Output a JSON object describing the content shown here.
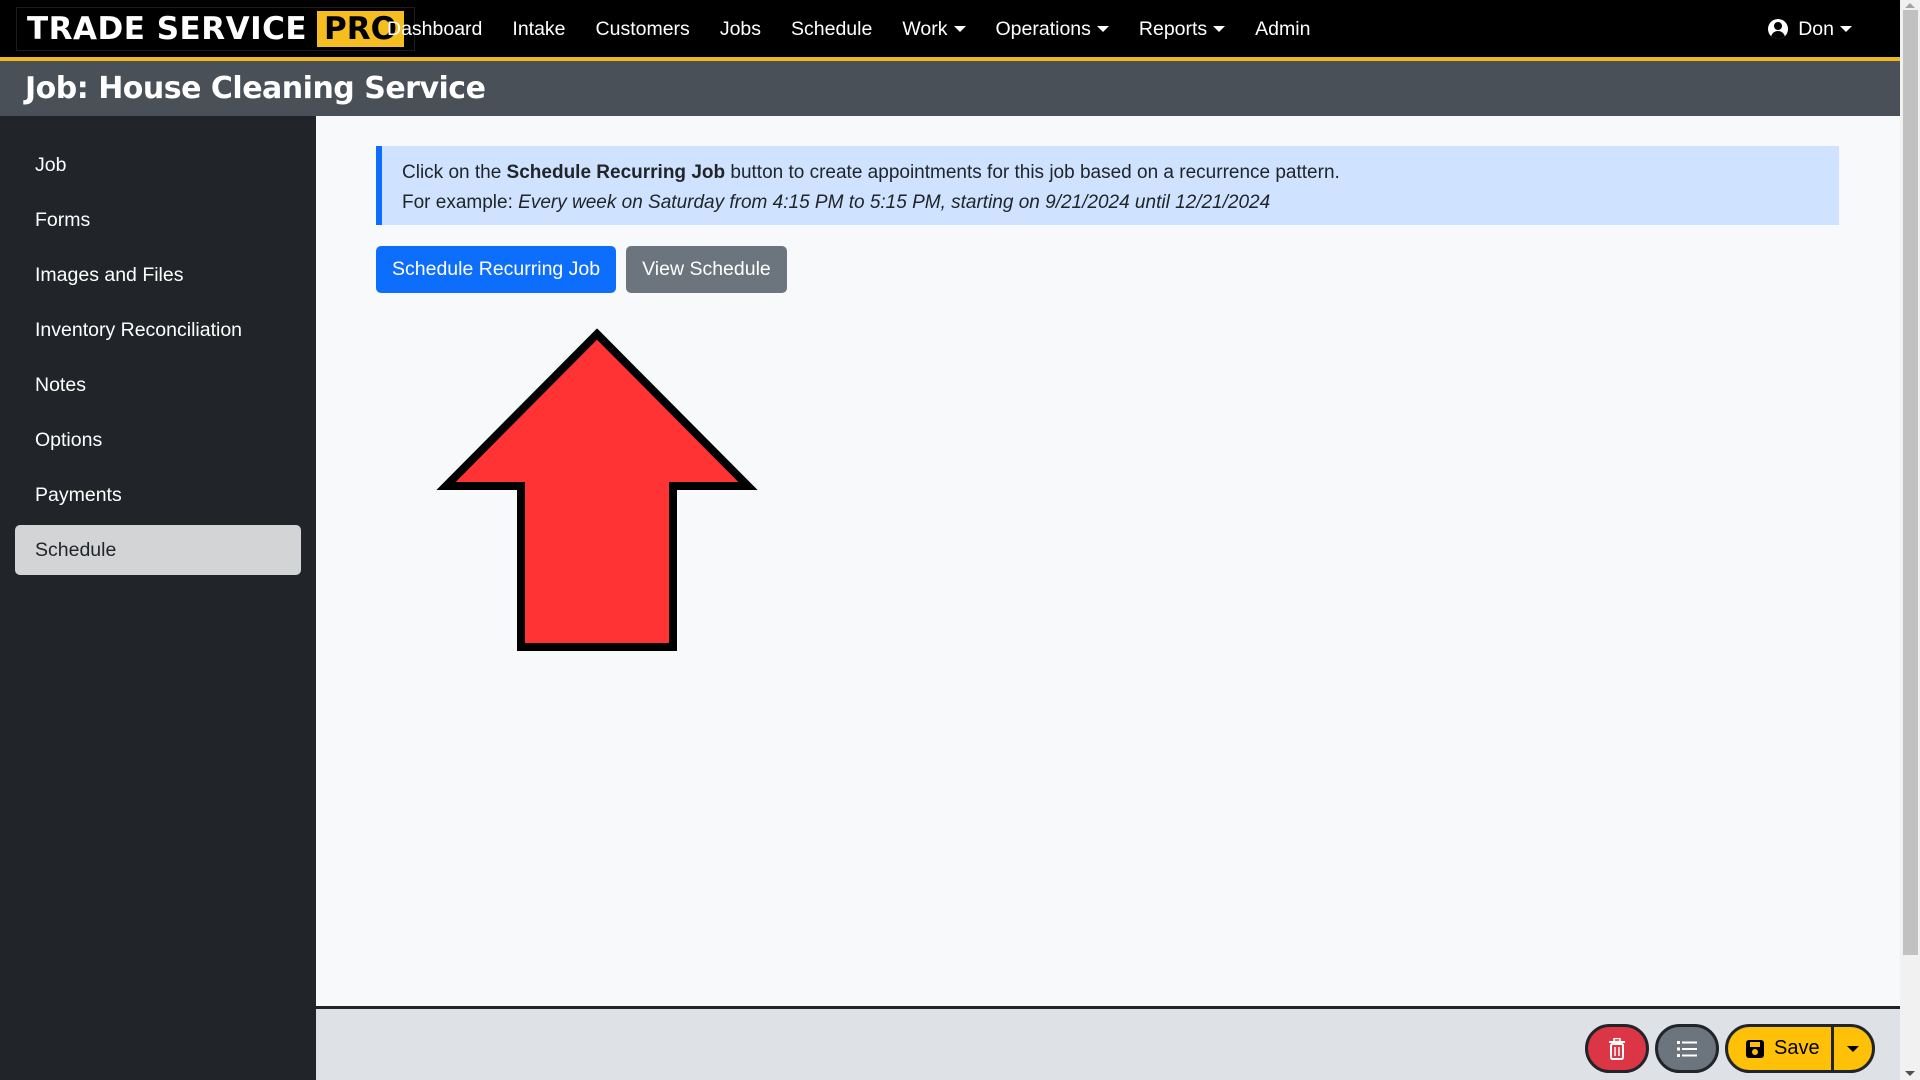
{
  "brand": {
    "name": "TRADE SERVICE",
    "badge": "PRO"
  },
  "nav": {
    "items": [
      {
        "label": "Dashboard",
        "dropdown": false
      },
      {
        "label": "Intake",
        "dropdown": false
      },
      {
        "label": "Customers",
        "dropdown": false
      },
      {
        "label": "Jobs",
        "dropdown": false
      },
      {
        "label": "Schedule",
        "dropdown": false
      },
      {
        "label": "Work",
        "dropdown": true
      },
      {
        "label": "Operations",
        "dropdown": true
      },
      {
        "label": "Reports",
        "dropdown": true
      },
      {
        "label": "Admin",
        "dropdown": false
      }
    ],
    "user": {
      "name": "Don",
      "icon": "user-circle-icon"
    }
  },
  "page": {
    "title": "Job: House Cleaning Service"
  },
  "sidebar": {
    "items": [
      {
        "label": "Job",
        "active": false
      },
      {
        "label": "Forms",
        "active": false
      },
      {
        "label": "Images and Files",
        "active": false
      },
      {
        "label": "Inventory Reconciliation",
        "active": false
      },
      {
        "label": "Notes",
        "active": false
      },
      {
        "label": "Options",
        "active": false
      },
      {
        "label": "Payments",
        "active": false
      },
      {
        "label": "Schedule",
        "active": true
      }
    ]
  },
  "alert": {
    "line1_prefix": "Click on the ",
    "line1_bold": "Schedule Recurring Job",
    "line1_suffix": " button to create appointments for this job based on a recurrence pattern.",
    "line2_prefix": "For example: ",
    "line2_italic": "Every week on Saturday from 4:15 PM to 5:15 PM, starting on 9/21/2024 until 12/21/2024"
  },
  "buttons": {
    "schedule_recurring": "Schedule Recurring Job",
    "view_schedule": "View Schedule"
  },
  "annotation": {
    "type": "up-arrow",
    "fill": "#ff3333",
    "stroke": "#000000"
  },
  "footer": {
    "delete_icon": "trash-icon",
    "list_icon": "list-icon",
    "save_label": "Save",
    "save_icon": "floppy-disk-icon"
  },
  "colors": {
    "navbar": "#000000",
    "accent": "#f2b71e",
    "titlebar": "#495057",
    "sidebar": "#212529",
    "primary": "#0d6efd",
    "secondary": "#6c757d",
    "danger": "#dc3545",
    "warning": "#ffc107"
  }
}
